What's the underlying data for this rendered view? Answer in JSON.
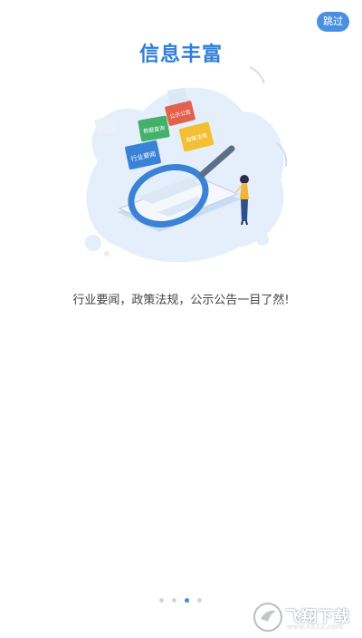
{
  "skip_button": {
    "label": "跳过"
  },
  "title": "信息丰富",
  "subtitle": "行业要闻，政策法规，公示公告一目了然!",
  "illustration": {
    "card_industry": "行业要闻",
    "card_data": "数据查询",
    "card_notice": "公示公告",
    "card_policy": "政策法规"
  },
  "pagination": {
    "total": 4,
    "active_index": 2
  },
  "watermark": {
    "text": "飞翔下载",
    "url": "www.FXXZ.com"
  },
  "colors": {
    "accent": "#2f7ed8",
    "blob": "#e4effb",
    "magnifier": "#3b82d6"
  }
}
